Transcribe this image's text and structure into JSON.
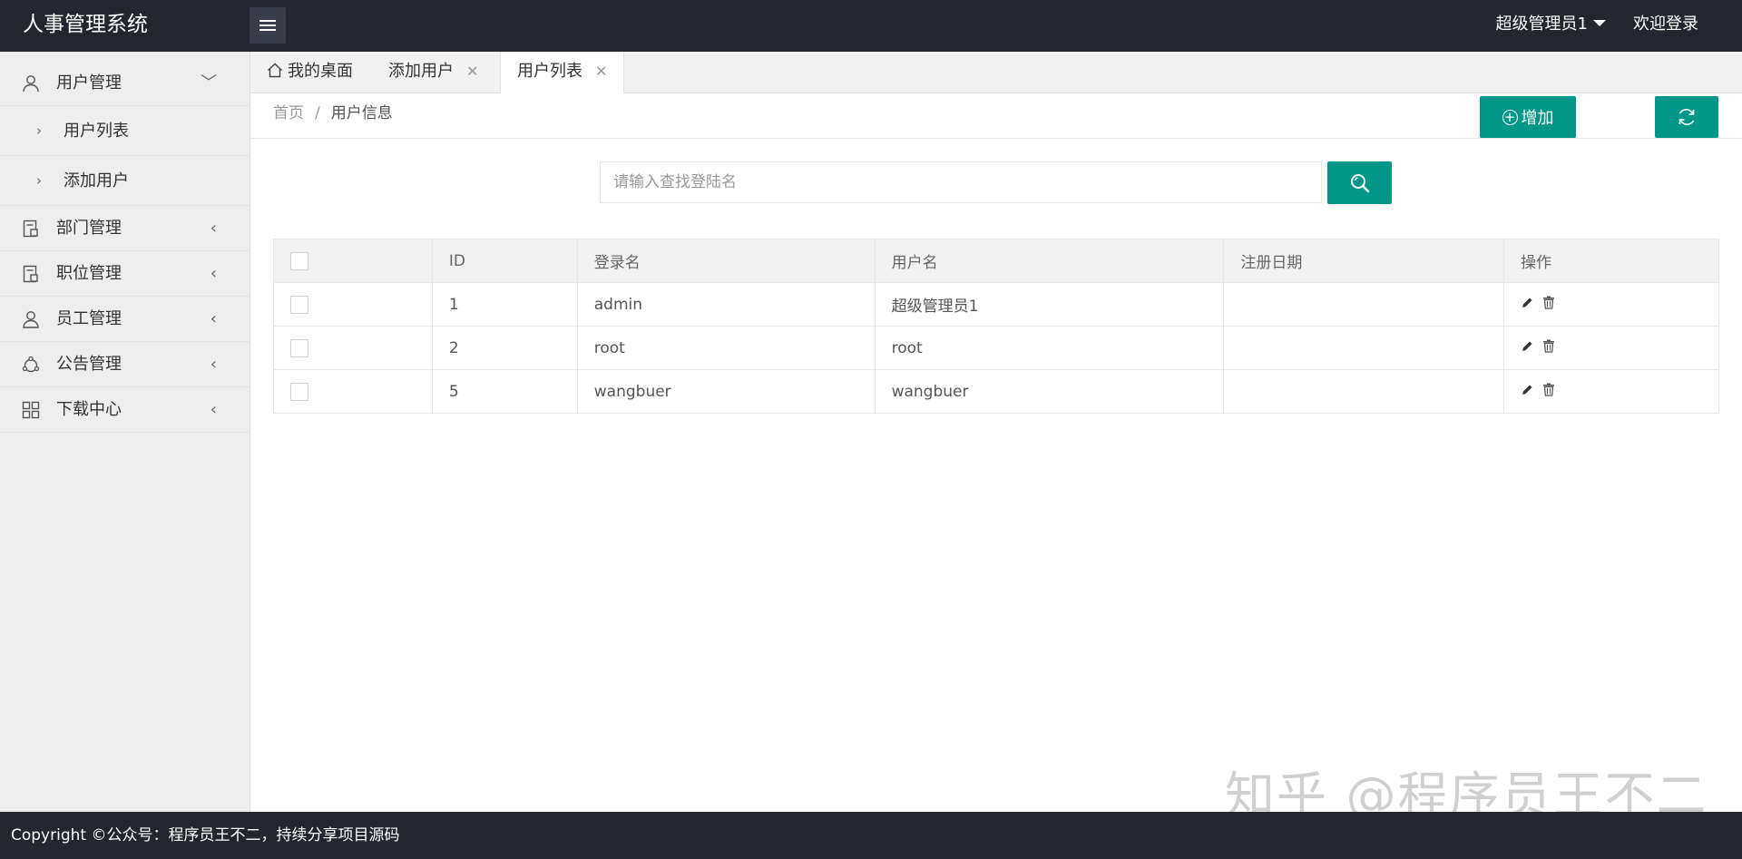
{
  "header": {
    "logo": "人事管理系统",
    "user_name": "超级管理员1",
    "welcome": "欢迎登录"
  },
  "sidebar": {
    "items": [
      {
        "label": "用户管理",
        "icon": "user-icon",
        "expanded": true,
        "children": [
          {
            "label": "用户列表"
          },
          {
            "label": "添加用户"
          }
        ]
      },
      {
        "label": "部门管理",
        "icon": "department-icon"
      },
      {
        "label": "职位管理",
        "icon": "position-icon"
      },
      {
        "label": "员工管理",
        "icon": "employee-icon"
      },
      {
        "label": "公告管理",
        "icon": "notice-icon"
      },
      {
        "label": "下载中心",
        "icon": "download-grid-icon"
      }
    ]
  },
  "tabs": [
    {
      "label": "我的桌面",
      "icon": "home-icon",
      "closable": false,
      "active": false
    },
    {
      "label": "添加用户",
      "closable": true,
      "active": false
    },
    {
      "label": "用户列表",
      "closable": true,
      "active": true
    }
  ],
  "breadcrumb": {
    "home": "首页",
    "separator": "/",
    "current": "用户信息"
  },
  "toolbar": {
    "add_label": "增加"
  },
  "search": {
    "placeholder": "请输入查找登陆名",
    "value": ""
  },
  "table": {
    "columns": [
      "",
      "ID",
      "登录名",
      "用户名",
      "注册日期",
      "操作"
    ],
    "rows": [
      {
        "id": "1",
        "login": "admin",
        "username": "超级管理员1",
        "date": ""
      },
      {
        "id": "2",
        "login": "root",
        "username": "root",
        "date": ""
      },
      {
        "id": "5",
        "login": "wangbuer",
        "username": "wangbuer",
        "date": ""
      }
    ]
  },
  "watermark": "知乎 @程序员王不二",
  "footer": {
    "text": "Copyright ©公众号：程序员王不二，持续分享项目源码"
  },
  "colors": {
    "primary": "#009688",
    "header_bg": "#23262e",
    "sidebar_bg": "#eeeeee"
  }
}
